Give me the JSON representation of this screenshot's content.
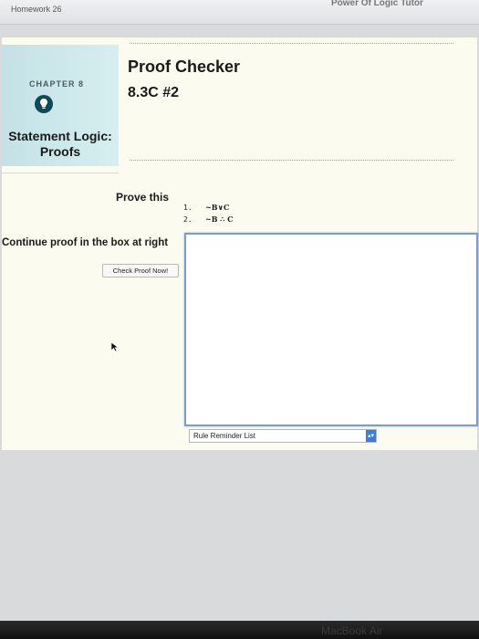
{
  "window": {
    "homework_title": "Homework 26",
    "app_title": "Power Of Logic Tutor"
  },
  "sidebar": {
    "chapter_label": "CHAPTER 8",
    "chapter_icon": "lightbulb-icon",
    "section_title_line1": "Statement Logic:",
    "section_title_line2": "Proofs"
  },
  "header": {
    "title": "Proof Checker",
    "problem_id": "8.3C #2"
  },
  "problem": {
    "prove_label": "Prove this",
    "premises": [
      {
        "num": "1.",
        "formula": "~B∨C"
      },
      {
        "num": "2.",
        "formula": "~B  ∴  C"
      }
    ]
  },
  "proof": {
    "instruction": "Continue proof in the box at right",
    "check_button_label": "Check Proof Now!",
    "box_value": ""
  },
  "rule_reminder": {
    "selected": "Rule Reminder List"
  },
  "device": {
    "bezel_label": "MacBook Air"
  },
  "colors": {
    "accent": "#0d4b5c",
    "card_background": "#c3e2e6",
    "panel_background": "#fbfbef",
    "proof_box_border": "#7c9cc9",
    "select_arrow": "#3a7de0"
  }
}
